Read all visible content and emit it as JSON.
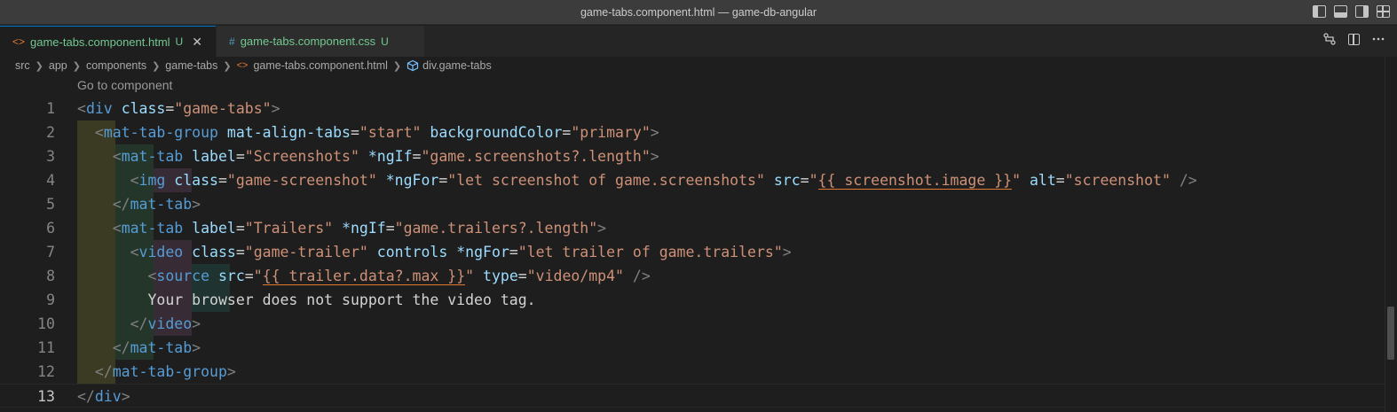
{
  "window": {
    "title": "game-tabs.component.html — game-db-angular"
  },
  "tabs": [
    {
      "icon": "html-icon",
      "icon_glyph": "<>",
      "label": "game-tabs.component.html",
      "status": "U",
      "close": "✕"
    },
    {
      "icon": "css-icon",
      "icon_glyph": "#",
      "label": "game-tabs.component.css",
      "status": "U"
    }
  ],
  "breadcrumb": {
    "items": [
      "src",
      "app",
      "components",
      "game-tabs",
      "game-tabs.component.html",
      "div.game-tabs"
    ]
  },
  "editor": {
    "codelens": "Go to component",
    "current_line": 13,
    "line_numbers": [
      "1",
      "2",
      "3",
      "4",
      "5",
      "6",
      "7",
      "8",
      "9",
      "10",
      "11",
      "12",
      "13"
    ],
    "lines": [
      "<div class=\"game-tabs\">",
      "  <mat-tab-group mat-align-tabs=\"start\" backgroundColor=\"primary\">",
      "    <mat-tab label=\"Screenshots\" *ngIf=\"game.screenshots?.length\">",
      "      <img class=\"game-screenshot\" *ngFor=\"let screenshot of game.screenshots\" src=\"{{ screenshot.image }}\" alt=\"screenshot\" />",
      "    </mat-tab>",
      "    <mat-tab label=\"Trailers\" *ngIf=\"game.trailers?.length\">",
      "      <video class=\"game-trailer\" controls *ngFor=\"let trailer of game.trailers\">",
      "        <source src=\"{{ trailer.data?.max }}\" type=\"video/mp4\" />",
      "        Your browser does not support the video tag.",
      "      </video>",
      "    </mat-tab>",
      "  </mat-tab-group>",
      "</div>"
    ]
  },
  "colors": {
    "tag": "#569cd6",
    "attribute": "#9cdcfe",
    "string": "#ce9178",
    "untracked": "#73c991",
    "accent": "#007acc"
  }
}
